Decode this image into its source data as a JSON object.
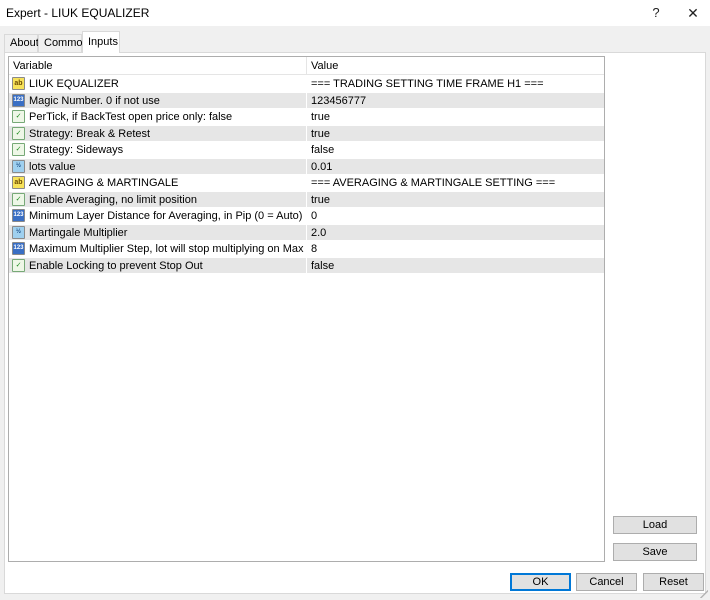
{
  "window": {
    "title": "Expert - LIUK EQUALIZER",
    "help_label": "?",
    "close_label": "✕"
  },
  "tabs": [
    {
      "label": "About"
    },
    {
      "label": "Common"
    },
    {
      "label": "Inputs",
      "active": true
    }
  ],
  "grid": {
    "headers": {
      "variable": "Variable",
      "value": "Value"
    },
    "rows": [
      {
        "icon": "string-icon",
        "icon_text": "ab",
        "variable": "LIUK EQUALIZER",
        "value": "=== TRADING SETTING TIME FRAME H1 ==="
      },
      {
        "icon": "integer-icon",
        "icon_text": "123",
        "variable": "Magic Number. 0 if not use",
        "value": "123456777"
      },
      {
        "icon": "bool-icon",
        "icon_text": "✓",
        "variable": "PerTick, if BackTest open price only: false",
        "value": "true"
      },
      {
        "icon": "bool-icon",
        "icon_text": "✓",
        "variable": "Strategy: Break & Retest",
        "value": "true"
      },
      {
        "icon": "bool-icon",
        "icon_text": "✓",
        "variable": "Strategy: Sideways",
        "value": "false"
      },
      {
        "icon": "double-icon",
        "icon_text": "½",
        "variable": "lots value",
        "value": "0.01"
      },
      {
        "icon": "string-icon",
        "icon_text": "ab",
        "variable": "AVERAGING & MARTINGALE",
        "value": "=== AVERAGING & MARTINGALE SETTING ==="
      },
      {
        "icon": "bool-icon",
        "icon_text": "✓",
        "variable": "Enable Averaging, no limit position",
        "value": "true"
      },
      {
        "icon": "integer-icon",
        "icon_text": "123",
        "variable": "Minimum Layer Distance for Averaging, in Pip (0 = Auto)",
        "value": "0"
      },
      {
        "icon": "double-icon",
        "icon_text": "½",
        "variable": "Martingale Multiplier",
        "value": "2.0"
      },
      {
        "icon": "integer-icon",
        "icon_text": "123",
        "variable": "Maximum Multiplier Step, lot will stop multiplying on Max",
        "value": "8"
      },
      {
        "icon": "bool-icon",
        "icon_text": "✓",
        "variable": "Enable Locking to prevent Stop Out",
        "value": "false"
      }
    ]
  },
  "buttons": {
    "load": "Load",
    "save": "Save",
    "ok": "OK",
    "cancel": "Cancel",
    "reset": "Reset"
  }
}
